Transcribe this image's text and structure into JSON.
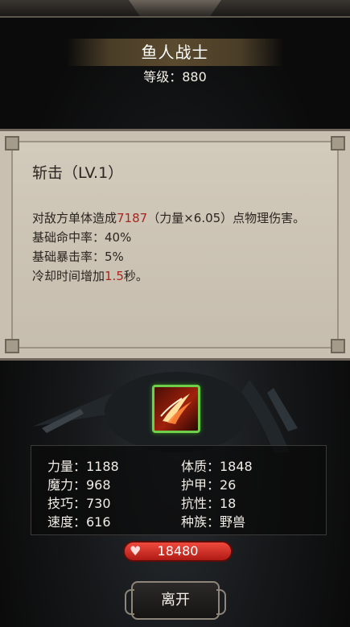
{
  "header": {
    "monster_name": "鱼人战士",
    "level_label": "等级：",
    "level_value": "880"
  },
  "skill": {
    "title": "斩击（LV.1）",
    "description": {
      "line1_prefix": "对敌方单体造成",
      "damage_value": "7187",
      "line1_suffix": "（力量×6.05）点物理伤害。",
      "hit_rate": "基础命中率：40%",
      "crit_rate": "基础暴击率：5%",
      "cooldown_prefix": "冷却时间增加",
      "cooldown_value": "1.5",
      "cooldown_suffix": "秒。"
    },
    "icon": "slash-skill-icon"
  },
  "stats": {
    "strength": "力量：1188",
    "magic": "魔力：968",
    "skill": "技巧：730",
    "speed": "速度：616",
    "constitution": "体质：1848",
    "armor": "护甲：26",
    "resistance": "抗性：18",
    "race": "种族：野兽"
  },
  "hp": {
    "value": "18480",
    "fill_fraction": 1.0,
    "icon": "heart-icon"
  },
  "actions": {
    "leave_label": "离开"
  },
  "colors": {
    "highlight_red": "#a8261f",
    "panel_bg": "#c9c0b1",
    "skill_border_green": "#6ed04a",
    "hp_red": "#d8302a"
  }
}
